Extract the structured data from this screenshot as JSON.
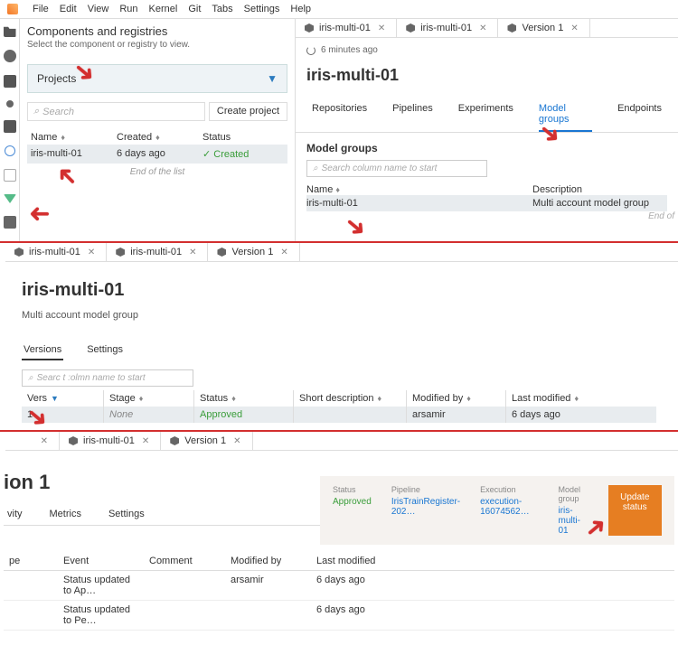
{
  "menubar": [
    "File",
    "Edit",
    "View",
    "Run",
    "Kernel",
    "Git",
    "Tabs",
    "Settings",
    "Help"
  ],
  "left": {
    "title": "Components and registries",
    "subtitle": "Select the component or registry to view.",
    "dropdown_label": "Projects",
    "search_placeholder": "Search",
    "create_btn": "Create project",
    "columns": {
      "name": "Name",
      "created": "Created",
      "status": "Status"
    },
    "row": {
      "name": "iris-multi-01",
      "created": "6 days ago",
      "status_check": "✓",
      "status": "Created"
    },
    "end": "End of the list"
  },
  "tabs_top": [
    {
      "label": "iris-multi-01"
    },
    {
      "label": "iris-multi-01"
    },
    {
      "label": "Version 1"
    }
  ],
  "project": {
    "refreshed": "6 minutes ago",
    "title": "iris-multi-01",
    "htabs": [
      "Repositories",
      "Pipelines",
      "Experiments",
      "Model groups",
      "Endpoints"
    ],
    "active_htab": "Model groups",
    "mg_header": "Model groups",
    "mg_search": "Search column name to start",
    "mg_cols": {
      "name": "Name",
      "desc": "Description"
    },
    "mg_row": {
      "name": "iris-multi-01",
      "desc": "Multi account model group"
    },
    "endof": "End of"
  },
  "tabs_mid": [
    {
      "label": "iris-multi-01"
    },
    {
      "label": "iris-multi-01"
    },
    {
      "label": "Version 1"
    }
  ],
  "mg_detail": {
    "title": "iris-multi-01",
    "subtitle": "Multi account model group",
    "tabs": [
      "Versions",
      "Settings"
    ],
    "search": "Searc t :olmn name to start",
    "cols": {
      "version": "Vers",
      "stage": "Stage",
      "status": "Status",
      "desc": "Short description",
      "by": "Modified by",
      "when": "Last modified"
    },
    "row": {
      "version": "1",
      "stage": "None",
      "status": "Approved",
      "desc": "",
      "by": "arsamir",
      "when": "6 days ago"
    }
  },
  "tabs_bot": [
    {
      "label": ""
    },
    {
      "label": "iris-multi-01"
    },
    {
      "label": "Version 1"
    }
  ],
  "version": {
    "title": "ion 1",
    "tabs": [
      "vity",
      "Metrics",
      "Settings"
    ],
    "info": {
      "status_lbl": "Status",
      "status": "Approved",
      "pipeline_lbl": "Pipeline",
      "pipeline": "IrisTrainRegister-202…",
      "execution_lbl": "Execution",
      "execution": "execution-16074562…",
      "mg_lbl": "Model group",
      "mg": "iris-multi-01",
      "update": "Update status"
    },
    "evt_cols": {
      "type": "pe",
      "event": "Event",
      "comment": "Comment",
      "by": "Modified by",
      "when": "Last modified"
    },
    "events": [
      {
        "event": "Status updated to Ap…",
        "comment": "",
        "by": "arsamir",
        "when": "6 days ago"
      },
      {
        "event": "Status updated to Pe…",
        "comment": "",
        "by": "",
        "when": "6 days ago"
      }
    ]
  }
}
